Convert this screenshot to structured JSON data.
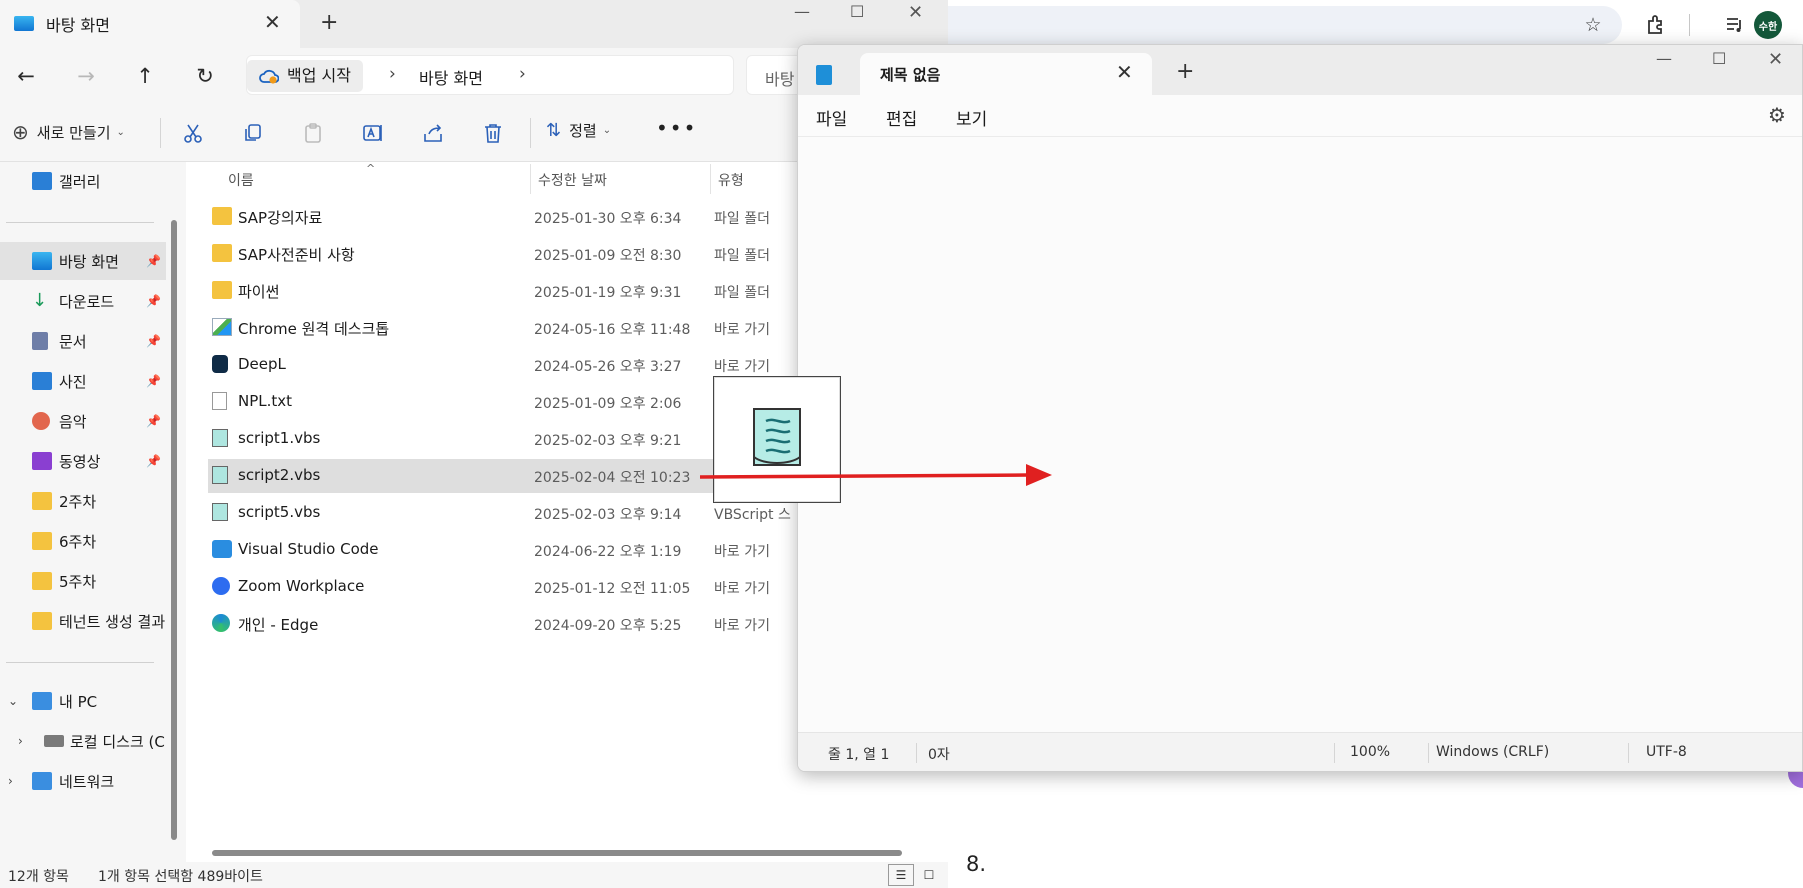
{
  "browser": {
    "profile_initials": "수한",
    "page_number": "8."
  },
  "explorer": {
    "tab_title": "바탕 화면",
    "breadcrumb": {
      "backup": "백업 시작",
      "current": "바탕 화면"
    },
    "search_placeholder": "바탕",
    "toolbar": {
      "new_label": "새로 만들기",
      "sort_label": "정렬"
    },
    "nav": {
      "items": [
        {
          "label": "갤러리"
        },
        {
          "label": "바탕 화면"
        },
        {
          "label": "다운로드"
        },
        {
          "label": "문서"
        },
        {
          "label": "사진"
        },
        {
          "label": "음악"
        },
        {
          "label": "동영상"
        },
        {
          "label": "2주차"
        },
        {
          "label": "6주차"
        },
        {
          "label": "5주차"
        },
        {
          "label": "테넌트 생성 결과"
        },
        {
          "label": "내 PC"
        },
        {
          "label": "로컬 디스크 (C:)"
        },
        {
          "label": "네트워크"
        }
      ]
    },
    "columns": {
      "name": "이름",
      "modified": "수정한 날짜",
      "type": "유형"
    },
    "files": [
      {
        "name": "SAP강의자료",
        "date": "2025-01-30 오후 6:34",
        "type": "파일 폴더"
      },
      {
        "name": "SAP사전준비 사항",
        "date": "2025-01-09 오전 8:30",
        "type": "파일 폴더"
      },
      {
        "name": "파이썬",
        "date": "2025-01-19 오후 9:31",
        "type": "파일 폴더"
      },
      {
        "name": "Chrome 원격 데스크톱",
        "date": "2024-05-16 오후 11:48",
        "type": "바로 가기"
      },
      {
        "name": "DeepL",
        "date": "2024-05-26 오후 3:27",
        "type": "바로 가기"
      },
      {
        "name": "NPL.txt",
        "date": "2025-01-09 오후 2:06",
        "type": ""
      },
      {
        "name": "script1.vbs",
        "date": "2025-02-03 오후 9:21",
        "type": ""
      },
      {
        "name": "script2.vbs",
        "date": "2025-02-04 오전 10:23",
        "type": ""
      },
      {
        "name": "script5.vbs",
        "date": "2025-02-03 오후 9:14",
        "type": "VBScript 스"
      },
      {
        "name": "Visual Studio Code",
        "date": "2024-06-22 오후 1:19",
        "type": "바로 가기"
      },
      {
        "name": "Zoom Workplace",
        "date": "2025-01-12 오전 11:05",
        "type": "바로 가기"
      },
      {
        "name": "개인 - Edge",
        "date": "2024-09-20 오후 5:25",
        "type": "바로 가기"
      }
    ],
    "status": {
      "count": "12개 항목",
      "selection": "1개 항목 선택함 489바이트"
    }
  },
  "notepad": {
    "tab_title": "제목 없음",
    "menu": {
      "file": "파일",
      "edit": "편집",
      "view": "보기"
    },
    "status": {
      "position": "줄 1, 열 1",
      "chars": "0자",
      "zoom": "100%",
      "line_ending": "Windows (CRLF)",
      "encoding": "UTF-8"
    }
  },
  "colors": {
    "arrow": "#e02020",
    "selection": "#dedede",
    "folder": "#f4c33f"
  }
}
